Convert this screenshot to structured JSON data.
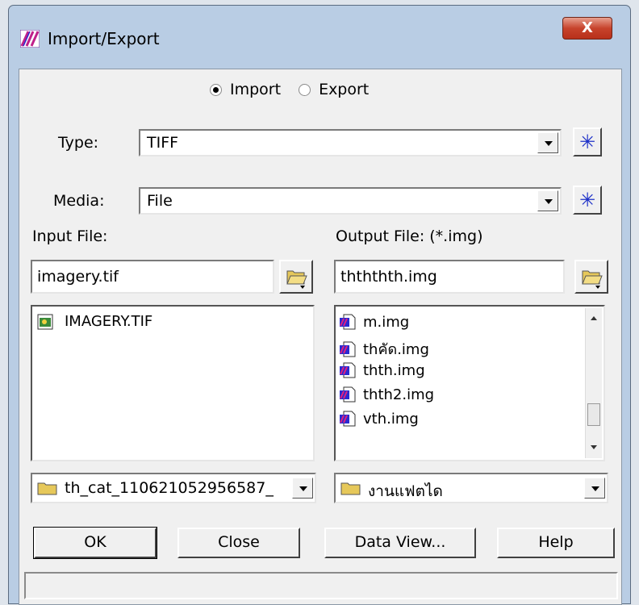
{
  "window": {
    "title": "Import/Export",
    "close_label": "X"
  },
  "mode": {
    "import_label": "Import",
    "export_label": "Export",
    "selected": "Import"
  },
  "type": {
    "label": "Type:",
    "value": "TIFF"
  },
  "media": {
    "label": "Media:",
    "value": "File"
  },
  "input": {
    "label": "Input File:",
    "filename": "imagery.tif",
    "files": [
      "IMAGERY.TIF"
    ],
    "folder": "th_cat_110621052956587_"
  },
  "output": {
    "label": "Output File: (*.img)",
    "filename": "thththth.img",
    "files": [
      "m.img",
      "thคัด.img",
      "thth.img",
      "thth2.img",
      "vth.img"
    ],
    "folder": "งานแฟตได"
  },
  "buttons": {
    "ok": "OK",
    "close": "Close",
    "data_view": "Data View...",
    "help": "Help"
  },
  "icons": {
    "star": "✳",
    "colors": {
      "star_blue": "#1b2fc8",
      "title_close_red": "#c7432c",
      "folder_yellow": "#e6c85a"
    }
  },
  "status_text": ""
}
